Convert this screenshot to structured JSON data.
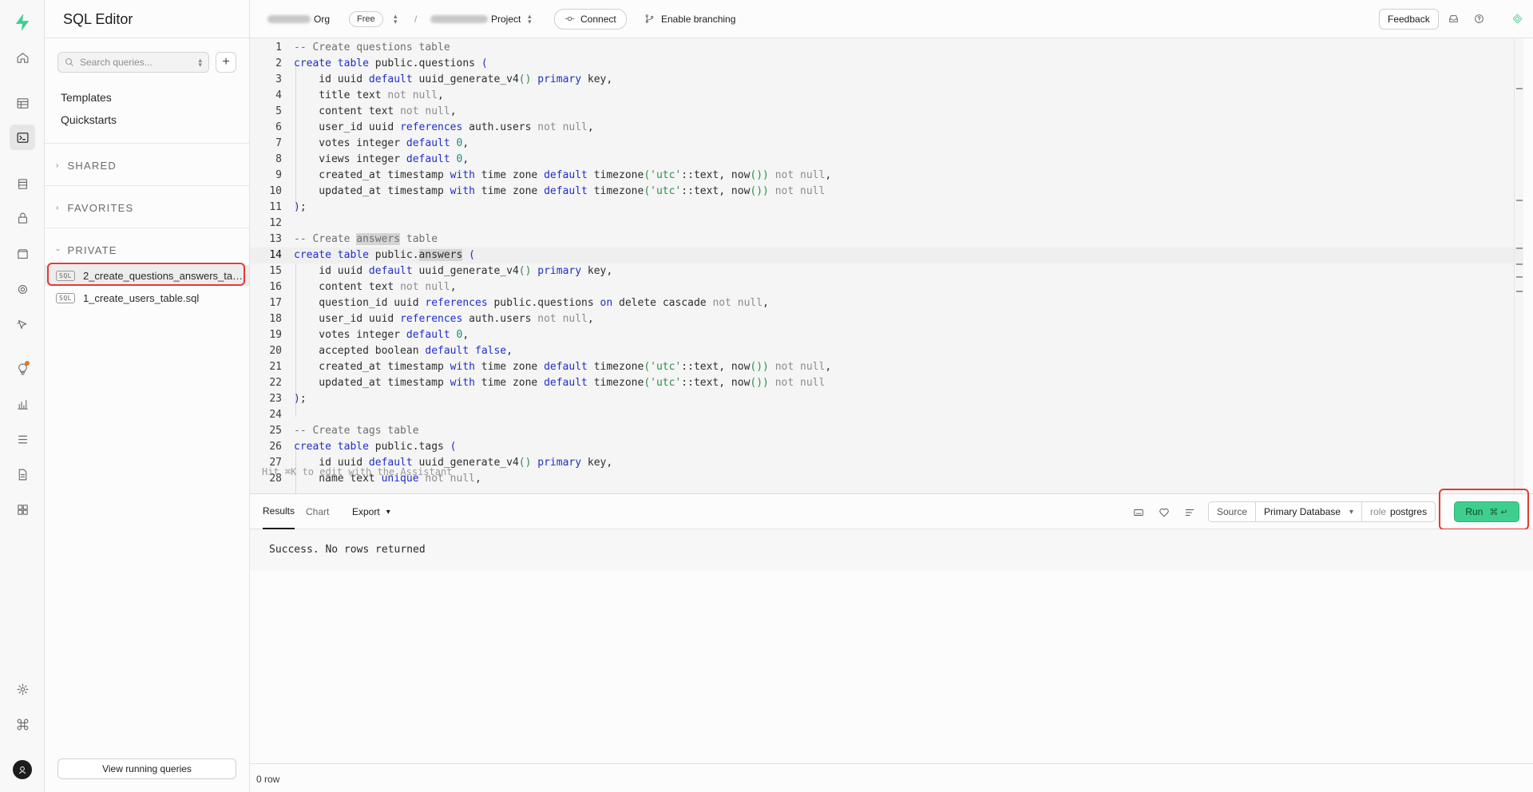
{
  "sidebar": {
    "title": "SQL Editor",
    "search_placeholder": "Search queries...",
    "links": [
      "Templates",
      "Quickstarts"
    ],
    "sections": {
      "shared": "SHARED",
      "favorites": "FAVORITES",
      "private": "PRIVATE"
    },
    "files": [
      {
        "name": "2_create_questions_answers_tables.sql",
        "tag": "SQL",
        "active": true
      },
      {
        "name": "1_create_users_table.sql",
        "tag": "SQL",
        "active": false
      }
    ],
    "view_running_label": "View running queries"
  },
  "topbar": {
    "org_suffix": "Org",
    "plan_badge": "Free",
    "separator": "/",
    "project_suffix": "Project",
    "connect_label": "Connect",
    "branching_label": "Enable branching",
    "feedback_label": "Feedback"
  },
  "editor": {
    "hint": "Hit ⌘K to edit with the Assistant",
    "current_line": 14,
    "line_numbers": [
      "1",
      "2",
      "3",
      "4",
      "5",
      "6",
      "7",
      "8",
      "9",
      "10",
      "11",
      "12",
      "13",
      "14",
      "15",
      "16",
      "17",
      "18",
      "19",
      "20",
      "21",
      "22",
      "23",
      "24",
      "25",
      "26",
      "27",
      "28"
    ],
    "lines": [
      "-- Create questions table",
      "create table public.questions (",
      "    id uuid default uuid_generate_v4() primary key,",
      "    title text not null,",
      "    content text not null,",
      "    user_id uuid references auth.users not null,",
      "    votes integer default 0,",
      "    views integer default 0,",
      "    created_at timestamp with time zone default timezone('utc'::text, now()) not null,",
      "    updated_at timestamp with time zone default timezone('utc'::text, now()) not null",
      ");",
      "",
      "-- Create answers table",
      "create table public.answers (",
      "    id uuid default uuid_generate_v4() primary key,",
      "    content text not null,",
      "    question_id uuid references public.questions on delete cascade not null,",
      "    user_id uuid references auth.users not null,",
      "    votes integer default 0,",
      "    accepted boolean default false,",
      "    created_at timestamp with time zone default timezone('utc'::text, now()) not null,",
      "    updated_at timestamp with time zone default timezone('utc'::text, now()) not null",
      ");",
      "",
      "-- Create tags table",
      "create table public.tags (",
      "    id uuid default uuid_generate_v4() primary key,",
      "    name text unique not null,"
    ]
  },
  "results": {
    "tabs": [
      "Results",
      "Chart"
    ],
    "export_label": "Export",
    "source_label": "Source",
    "database_label": "Primary Database",
    "role_prefix": "role",
    "role_value": "postgres",
    "run_label": "Run",
    "run_shortcut": "⌘ ↵",
    "message": "Success. No rows returned",
    "row_count": "0 row"
  },
  "colors": {
    "brand": "#3ecf8e",
    "keyword": "#1f2fc9",
    "string": "#2a8f4a",
    "highlight_box": "#e53935"
  }
}
